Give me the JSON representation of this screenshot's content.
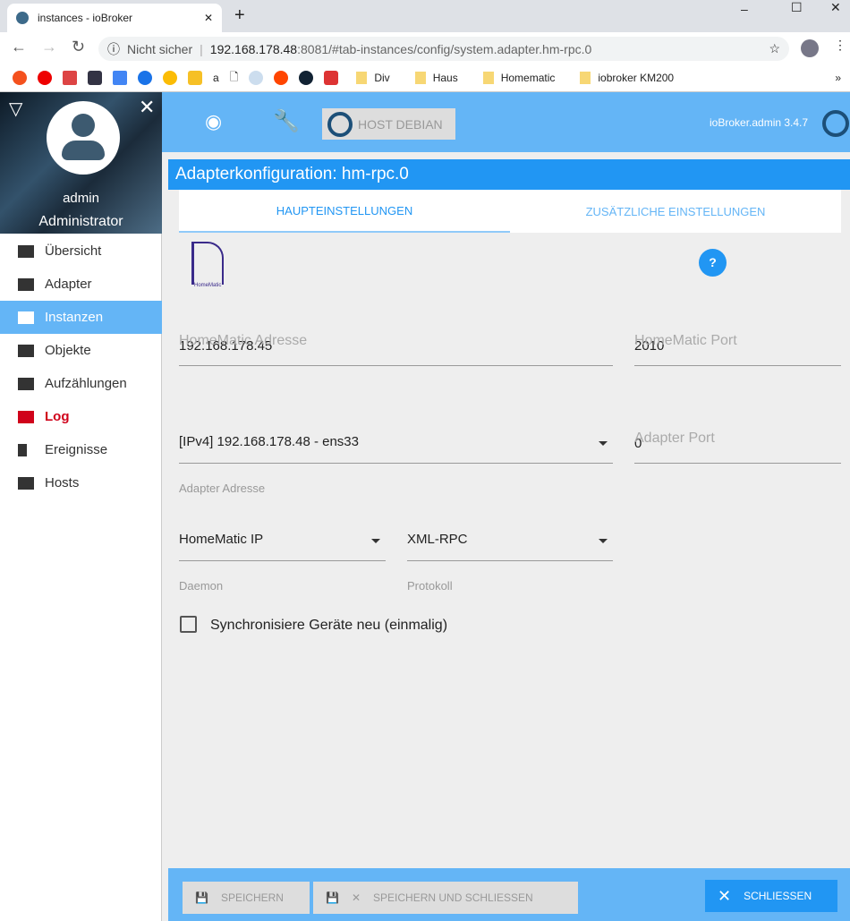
{
  "browser": {
    "tab_title": "instances - ioBroker",
    "security": "Nicht sicher",
    "url_host": "192.168.178.48",
    "url_rest": ":8081/#tab-instances/config/system.adapter.hm-rpc.0",
    "bookmarks": [
      "Div",
      "Haus",
      "Homematic",
      "iobroker KM200"
    ]
  },
  "sidebar": {
    "user": "admin",
    "role": "Administrator",
    "items": [
      {
        "label": "Übersicht"
      },
      {
        "label": "Adapter"
      },
      {
        "label": "Instanzen"
      },
      {
        "label": "Objekte"
      },
      {
        "label": "Aufzählungen"
      },
      {
        "label": "Log"
      },
      {
        "label": "Ereignisse"
      },
      {
        "label": "Hosts"
      }
    ]
  },
  "topbar": {
    "host": "HOST DEBIAN",
    "version": "ioBroker.admin 3.4.7"
  },
  "config": {
    "title": "Adapterkonfiguration: hm-rpc.0",
    "tabs": [
      "HAUPTEINSTELLUNGEN",
      "ZUSÄTZLICHE EINSTELLUNGEN"
    ],
    "logo_text": "HomeMatic",
    "hm_address_label": "HomeMatic Adresse",
    "hm_address": "192.168.178.45",
    "hm_port_label": "HomeMatic Port",
    "hm_port": "2010",
    "adapter_address": "[IPv4] 192.168.178.48 - ens33",
    "adapter_address_label": "Adapter Adresse",
    "adapter_port_label": "Adapter Port",
    "adapter_port": "0",
    "daemon": "HomeMatic IP",
    "daemon_label": "Daemon",
    "protocol": "XML-RPC",
    "protocol_label": "Protokoll",
    "sync_label": "Synchronisiere Geräte neu (einmalig)"
  },
  "footer": {
    "save": "SPEICHERN",
    "save_close": "SPEICHERN UND SCHLIESSEN",
    "close": "SCHLIESSEN"
  }
}
